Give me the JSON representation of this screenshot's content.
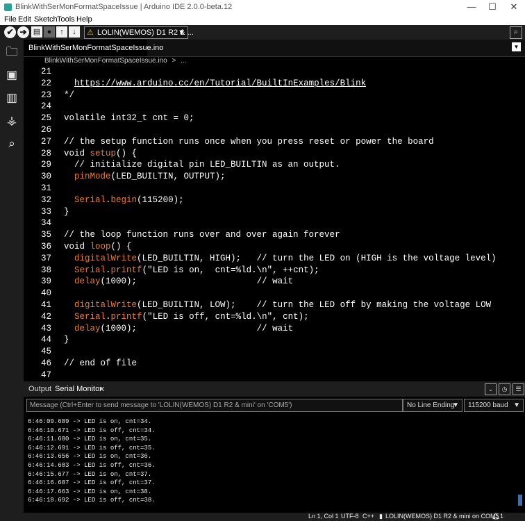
{
  "window": {
    "title": "BlinkWithSerMonFormatSpaceIssue | Arduino IDE 2.0.0-beta.12",
    "minimize": "—",
    "maximize": "☐",
    "close": "✕"
  },
  "menu": [
    "File",
    "Edit",
    "Sketch",
    "Tools",
    "Help"
  ],
  "toolbar": {
    "verify_icon": "✔",
    "upload_icon": "➔",
    "new_icon": "▤",
    "debug_icon": "●",
    "open_icon": "↑",
    "save_icon": "↓",
    "board_warning": "⚠",
    "board_name": "LOLIN(WEMOS) D1 R2 & ...",
    "board_dropdown": "▼",
    "serial_plotter_icon": "⌕"
  },
  "sidebar": {
    "icons": [
      "sketchbook-icon",
      "boards-manager-icon",
      "library-manager-icon",
      "debug-icon",
      "search-icon"
    ],
    "glyphs": [
      "🗀",
      "▣",
      "▥",
      "⚶",
      "⌕"
    ]
  },
  "tab": {
    "filename": "BlinkWithSerMonFormatSpaceIssue.ino",
    "menu_glyph": "▼"
  },
  "breadcrumb": {
    "file": "BlinkWithSerMonFormatSpaceIssue.ino",
    "sep": ">",
    "rest": "..."
  },
  "code_lines": [
    {
      "n": "21",
      "t": ""
    },
    {
      "n": "22",
      "t": "  https://www.arduino.cc/en/Tutorial/BuiltInExamples/Blink"
    },
    {
      "n": "23",
      "t": "*/"
    },
    {
      "n": "24",
      "t": ""
    },
    {
      "n": "25",
      "t": "volatile int32_t cnt = 0;"
    },
    {
      "n": "26",
      "t": ""
    },
    {
      "n": "27",
      "t": "// the setup function runs once when you press reset or power the board"
    },
    {
      "n": "28",
      "t": "void setup() {"
    },
    {
      "n": "29",
      "t": "  // initialize digital pin LED_BUILTIN as an output."
    },
    {
      "n": "30",
      "t": "  pinMode(LED_BUILTIN, OUTPUT);"
    },
    {
      "n": "31",
      "t": ""
    },
    {
      "n": "32",
      "t": "  Serial.begin(115200);"
    },
    {
      "n": "33",
      "t": "}"
    },
    {
      "n": "34",
      "t": ""
    },
    {
      "n": "35",
      "t": "// the loop function runs over and over again forever"
    },
    {
      "n": "36",
      "t": "void loop() {"
    },
    {
      "n": "37",
      "t": "  digitalWrite(LED_BUILTIN, HIGH);   // turn the LED on (HIGH is the voltage level)"
    },
    {
      "n": "38",
      "t": "  Serial.printf(\"LED is on,  cnt=%ld.\\n\", ++cnt);"
    },
    {
      "n": "39",
      "t": "  delay(1000);                       // wait"
    },
    {
      "n": "40",
      "t": ""
    },
    {
      "n": "41",
      "t": "  digitalWrite(LED_BUILTIN, LOW);    // turn the LED off by making the voltage LOW"
    },
    {
      "n": "42",
      "t": "  Serial.printf(\"LED is off, cnt=%ld.\\n\", cnt);"
    },
    {
      "n": "43",
      "t": "  delay(1000);                       // wait"
    },
    {
      "n": "44",
      "t": "}"
    },
    {
      "n": "45",
      "t": ""
    },
    {
      "n": "46",
      "t": "// end of file"
    },
    {
      "n": "47",
      "t": ""
    }
  ],
  "output_panel": {
    "tab_output": "Output",
    "tab_serial": "Serial Monitor",
    "tab_close": "✕",
    "autoscroll_icon": "⌄",
    "timestamp_icon": "◷",
    "clear_icon": "☰",
    "message_placeholder": "Message (Ctrl+Enter to send message to 'LOLIN(WEMOS) D1 R2 & mini' on 'COM5')",
    "line_ending": "No Line Ending",
    "baud": "115200 baud",
    "dropdown": "▼"
  },
  "serial_lines": [
    "6:46:09.689 -> LED is on, cnt=34.",
    "6:46:10.671 -> LED is off, cnt=34.",
    "6:46:11.680 -> LED is on, cnt=35.",
    "6:46:12.691 -> LED is off, cnt=35.",
    "6:46:13.656 -> LED is on, cnt=36.",
    "6:46:14.683 -> LED is off, cnt=36.",
    "6:46:15.677 -> LED is on, cnt=37.",
    "6:46:16.687 -> LED is off, cnt=37.",
    "6:46:17.663 -> LED is on, cnt=38.",
    "6:46:18.692 -> LED is off, cnt=38."
  ],
  "statusbar": {
    "position": "Ln 1, Col 1",
    "encoding": "UTF-8",
    "language": "C++",
    "board": "LOLIN(WEMOS) D1 R2 & mini on COM5",
    "notifications": "1"
  }
}
